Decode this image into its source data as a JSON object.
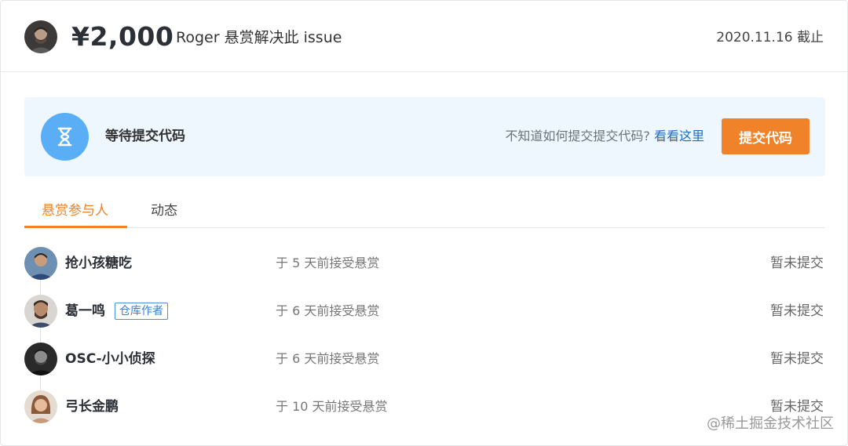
{
  "header": {
    "amount": "¥2,000",
    "title": "Roger 悬赏解决此 issue",
    "deadline": "2020.11.16 截止",
    "avatar_icon": "user-avatar-icon"
  },
  "status": {
    "icon": "hourglass-icon",
    "text": "等待提交代码",
    "help_text": "不知道如何提交提交代码?",
    "help_link": "看看这里",
    "submit_label": "提交代码",
    "accent_color": "#f0832a",
    "panel_color": "#eef7fe"
  },
  "tabs": [
    {
      "label": "悬赏参与人",
      "active": true
    },
    {
      "label": "动态",
      "active": false
    }
  ],
  "participants": [
    {
      "name": "抢小孩糖吃",
      "badge": "",
      "accepted": "于 5 天前接受悬赏",
      "state": "暂未提交"
    },
    {
      "name": "葛一鸣",
      "badge": "仓库作者",
      "accepted": "于 6 天前接受悬赏",
      "state": "暂未提交"
    },
    {
      "name": "OSC-小小侦探",
      "badge": "",
      "accepted": "于 6 天前接受悬赏",
      "state": "暂未提交"
    },
    {
      "name": "弓长金鹏",
      "badge": "",
      "accepted": "于 10 天前接受悬赏",
      "state": "暂未提交"
    }
  ],
  "watermark": "@稀土掘金技术社区"
}
